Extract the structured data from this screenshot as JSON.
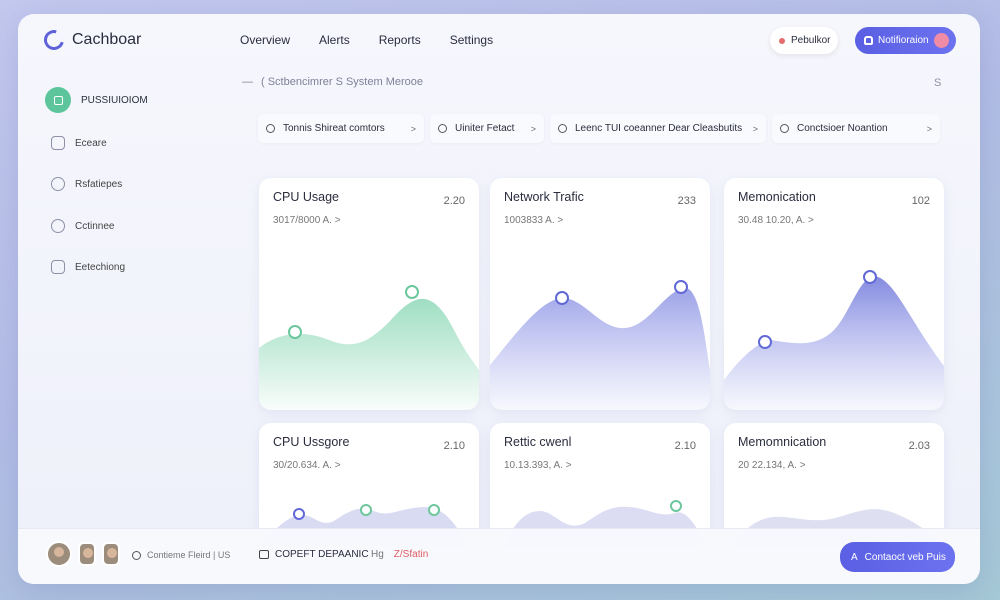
{
  "app": {
    "title": "Cachboar"
  },
  "topnav": [
    "Overview",
    "Alerts",
    "Reports",
    "Settings"
  ],
  "header": {
    "btn_white": "Pebulkor",
    "btn_blue": "Notifioraion"
  },
  "sidebar": {
    "items": [
      {
        "label": "PUSSIUIOIOM",
        "active": true
      },
      {
        "label": "Eceare"
      },
      {
        "label": "Rsfatiepes"
      },
      {
        "label": "Cctinnee"
      },
      {
        "label": "Eetechiong"
      }
    ]
  },
  "breadcrumb": {
    "dash": "—",
    "text": "( Sctbencimrer S System Merooe",
    "right": "S"
  },
  "filters": [
    {
      "label": "Tonnis Shireat comtors"
    },
    {
      "label": "Uiniter Fetact"
    },
    {
      "label": "Leenc TUI coeanner Dear Cleasbutits"
    },
    {
      "label": "Conctsioer Noantion"
    }
  ],
  "cards": [
    {
      "title": "CPU Usage",
      "value": "2.20",
      "sub": "3017/8000 A. >"
    },
    {
      "title": "Network Trafic",
      "value": "233",
      "sub": "1003833 A. >"
    },
    {
      "title": "Memonication",
      "value": "102",
      "sub": "30.48 10.20, A. >"
    },
    {
      "title": "CPU Ussgore",
      "value": "2.10",
      "sub": "30/20.634. A. >"
    },
    {
      "title": "Rettic cwenl",
      "value": "2.10",
      "sub": "10.13.393, A. >"
    },
    {
      "title": "Memomnication",
      "value": "2.03",
      "sub": "20 22.134, A. >"
    }
  ],
  "footer": {
    "team": "Contieme Fleird | US",
    "doc": "COPEFT DEPAANIC",
    "sig1": "Hg",
    "sig2": "Z/Sfatin",
    "contact": "Contaoct veb Puis"
  },
  "colors": {
    "accent": "#5a5fe3",
    "green": "#5cc59c",
    "red": "#e36d6d"
  },
  "icons": {
    "logo": "spinner-ring-icon",
    "sidebar": [
      "dashboard-icon",
      "folder-icon",
      "clipboard-icon",
      "gear-icon",
      "document-icon"
    ]
  }
}
